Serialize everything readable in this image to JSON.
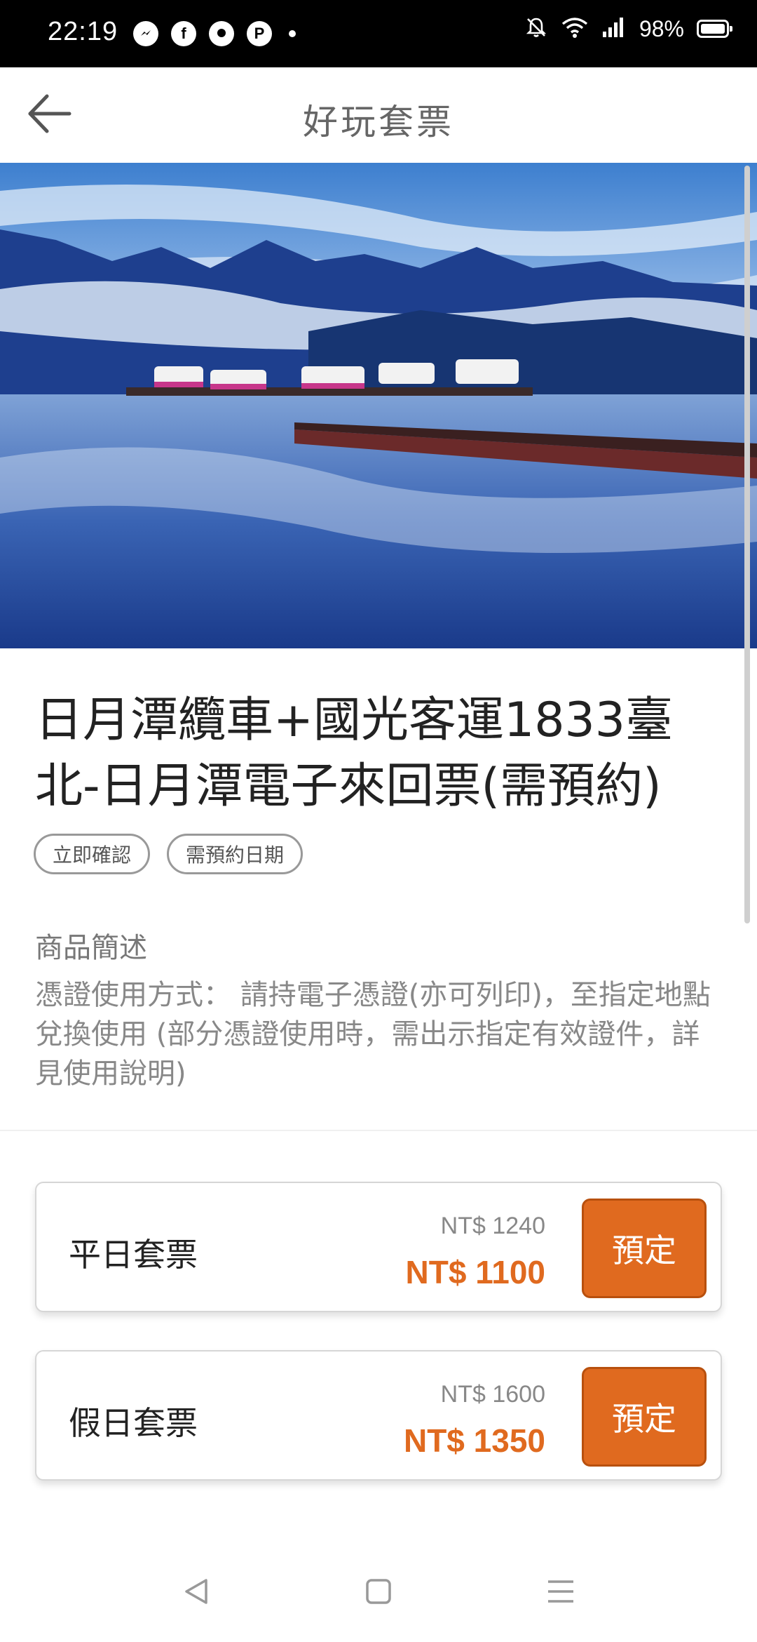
{
  "status_bar": {
    "time": "22:19",
    "battery": "98%",
    "notification_icons": [
      "messenger-icon",
      "facebook-icon",
      "chat-icon",
      "pinterest-icon"
    ],
    "status_icons": [
      "bell-off-icon",
      "wifi-icon",
      "signal-icon",
      "battery-icon"
    ]
  },
  "app_bar": {
    "title": "好玩套票",
    "back_icon": "arrow-left-icon"
  },
  "hero_image": {
    "description_icon": "lake-photo"
  },
  "product": {
    "title": "日月潭纜車+國光客運1833臺北-日月潭電子來回票(需預約)",
    "tags": [
      "立即確認",
      "需預約日期"
    ],
    "section_label": "商品簡述",
    "description": "憑證使用方式： 請持電子憑證(亦可列印)，至指定地點兌換使用 (部分憑證使用時，需出示指定有效證件，詳見使用說明)"
  },
  "packages": [
    {
      "name": "平日套票",
      "original_price": "NT$ 1240",
      "price": "NT$ 1100",
      "button": "預定"
    },
    {
      "name": "假日套票",
      "original_price": "NT$ 1600",
      "price": "NT$ 1350",
      "button": "預定"
    }
  ],
  "colors": {
    "accent": "#e06a1f",
    "status_bar": "#000000",
    "title_text": "#222222"
  },
  "nav_bar": {
    "buttons": [
      "back-triangle-icon",
      "home-square-icon",
      "menu-lines-icon"
    ]
  }
}
